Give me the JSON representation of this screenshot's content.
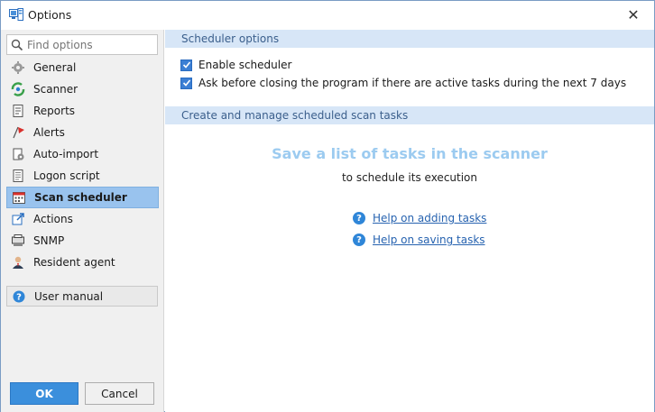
{
  "window": {
    "title": "Options",
    "close_glyph": "✕"
  },
  "sidebar": {
    "search_placeholder": "Find options",
    "items": [
      {
        "label": "General",
        "icon": "gear-icon"
      },
      {
        "label": "Scanner",
        "icon": "scanner-icon"
      },
      {
        "label": "Reports",
        "icon": "reports-icon"
      },
      {
        "label": "Alerts",
        "icon": "alert-flag-icon"
      },
      {
        "label": "Auto-import",
        "icon": "auto-import-icon"
      },
      {
        "label": "Logon script",
        "icon": "script-icon"
      },
      {
        "label": "Scan scheduler",
        "icon": "calendar-icon",
        "selected": true
      },
      {
        "label": "Actions",
        "icon": "actions-icon"
      },
      {
        "label": "SNMP",
        "icon": "snmp-icon"
      },
      {
        "label": "Resident agent",
        "icon": "agent-icon"
      }
    ],
    "user_manual": "User manual",
    "ok_label": "OK",
    "cancel_label": "Cancel"
  },
  "main": {
    "scheduler_options_header": "Scheduler options",
    "enable_scheduler": "Enable scheduler",
    "ask_before_closing": "Ask before closing the program if there are active tasks during the next 7 days",
    "manage_header": "Create and manage scheduled scan tasks",
    "empty_title": "Save a list of tasks in the scanner",
    "empty_subtitle": "to schedule its execution",
    "help_adding": "Help on adding tasks",
    "help_saving": "Help on saving tasks"
  },
  "colors": {
    "accent": "#3b8fdc",
    "selected_bg": "#99c3ee",
    "header_bg": "#d7e6f7",
    "empty_title": "#9ccbf0"
  }
}
